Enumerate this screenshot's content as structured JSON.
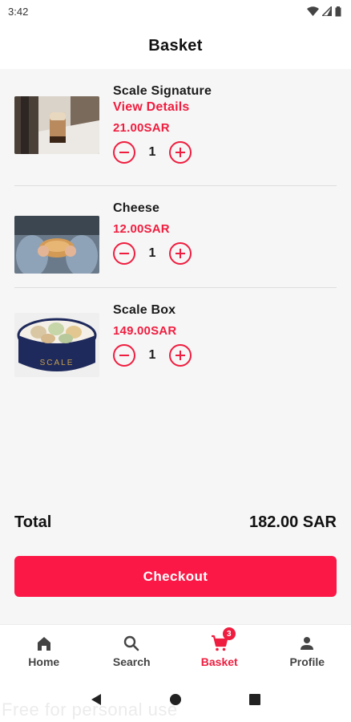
{
  "status_bar": {
    "time": "3:42"
  },
  "header": {
    "title": "Basket"
  },
  "items": [
    {
      "name": "Scale Signature",
      "link": "View Details",
      "price": "21.00SAR",
      "quantity": "1"
    },
    {
      "name": "Cheese",
      "price": "12.00SAR",
      "quantity": "1"
    },
    {
      "name": "Scale Box",
      "price": "149.00SAR",
      "quantity": "1"
    }
  ],
  "product_images": {
    "box_label": "SCALE"
  },
  "summary": {
    "total_label": "Total",
    "total_value": "182.00 SAR"
  },
  "checkout": {
    "label": "Checkout"
  },
  "bottom_nav": {
    "items": [
      {
        "label": "Home",
        "icon": "home-icon"
      },
      {
        "label": "Search",
        "icon": "search-icon"
      },
      {
        "label": "Basket",
        "icon": "cart-icon",
        "badge": "3",
        "active": true
      },
      {
        "label": "Profile",
        "icon": "person-icon"
      }
    ]
  },
  "watermark": "Free for personal use",
  "colors": {
    "accent": "#ef1d3f",
    "checkout_button": "#fb1846",
    "background": "#f6f6f6"
  }
}
